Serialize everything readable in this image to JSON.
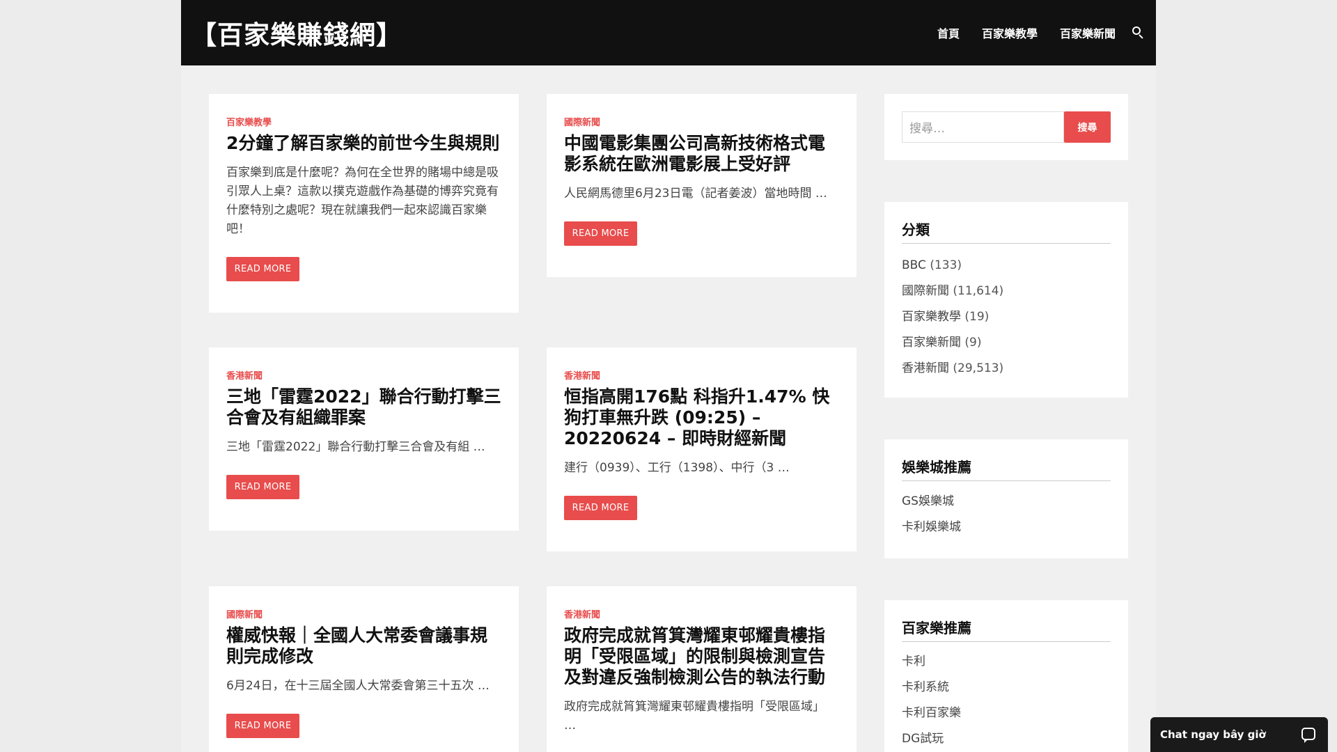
{
  "header": {
    "site_title": "【百家樂賺錢網】",
    "nav": [
      "首頁",
      "百家樂教學",
      "百家樂新聞"
    ]
  },
  "posts": [
    {
      "category": "百家樂教學",
      "title": "2分鐘了解百家樂的前世今生與規則",
      "excerpt": "百家樂到底是什麼呢？為何在全世界的賭場中總是吸引眾人上桌？這款以撲克遊戲作為基礎的博弈究竟有什麼特別之處呢？現在就讓我們一起來認識百家樂吧！",
      "button": "READ MORE"
    },
    {
      "category": "國際新聞",
      "title": "中國電影集團公司高新技術格式電影系統在歐洲電影展上受好評",
      "excerpt": "人民網馬德里6月23日電（記者姜波）當地時間 …",
      "button": "READ MORE"
    },
    {
      "category": "香港新聞",
      "title": "三地「雷霆2022」聯合行動打擊三合會及有組織罪案",
      "excerpt": "三地「雷霆2022」聯合行動打擊三合會及有組 …",
      "button": "READ MORE"
    },
    {
      "category": "香港新聞",
      "title": "恒指高開176點 科指升1.47% 快狗打車無升跌 (09:25) – 20220624 – 即時財經新聞",
      "excerpt": "建行（0939）、工行（1398）、中行（3 …",
      "button": "READ MORE"
    },
    {
      "category": "國際新聞",
      "title": "權威快報｜全國人大常委會議事規則完成修改",
      "excerpt": "6月24日，在十三屆全國人大常委會第三十五次 …",
      "button": "READ MORE"
    },
    {
      "category": "香港新聞",
      "title": "政府完成就筲箕灣耀東邨耀貴樓指明「受限區域」的限制與檢測宣告及對違反強制檢測公告的執法行動",
      "excerpt": "政府完成就筲箕灣耀東邨耀貴樓指明「受限區域」 …",
      "button": "READ MORE"
    }
  ],
  "search": {
    "placeholder": "搜尋…",
    "button": "搜尋"
  },
  "widgets": {
    "categories": {
      "title": "分類",
      "items": [
        {
          "name": "BBC",
          "count": "(133)"
        },
        {
          "name": "國際新聞",
          "count": "(11,614)"
        },
        {
          "name": "百家樂教學",
          "count": "(19)"
        },
        {
          "name": "百家樂新聞",
          "count": "(9)"
        },
        {
          "name": "香港新聞",
          "count": "(29,513)"
        }
      ]
    },
    "casinos": {
      "title": "娛樂城推薦",
      "items": [
        "GS娛樂城",
        "卡利娛樂城"
      ]
    },
    "baccarat": {
      "title": "百家樂推薦",
      "items": [
        "卡利",
        "卡利系統",
        "卡利百家樂",
        "DG試玩"
      ]
    }
  },
  "chat": {
    "label": "Chat ngay bây giờ"
  },
  "colors": {
    "accent": "#e84c4c",
    "header_bg": "#111111"
  }
}
